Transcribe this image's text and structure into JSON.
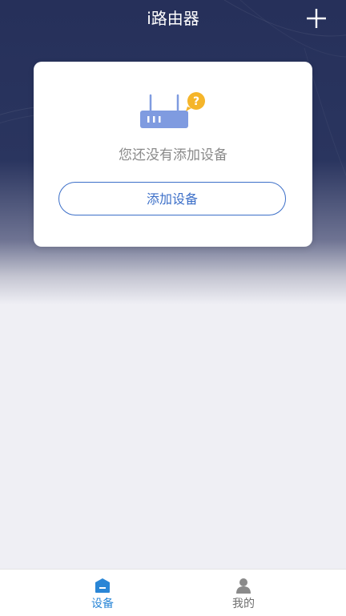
{
  "header": {
    "title": "i路由器",
    "add_icon": "plus-icon"
  },
  "empty_state": {
    "illustration_icon": "router-question-icon",
    "message": "您还没有添加设备",
    "add_button_label": "添加设备"
  },
  "tabbar": {
    "tabs": [
      {
        "label": "设备",
        "icon": "device-home-icon",
        "active": true
      },
      {
        "label": "我的",
        "icon": "person-icon",
        "active": false
      }
    ]
  },
  "colors": {
    "header_bg": "#26305a",
    "accent": "#3c6fc8",
    "tab_active": "#2a86d6",
    "badge": "#f5b52a",
    "router": "#7f9be0"
  }
}
